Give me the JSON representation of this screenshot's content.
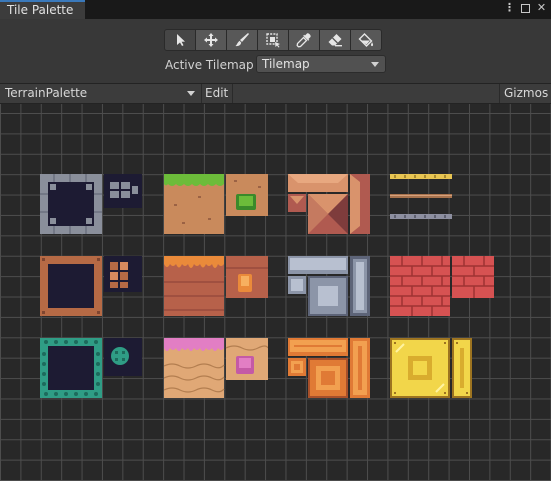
{
  "window": {
    "tab_title": "Tile Palette",
    "menu_icon": "kebab-menu-icon",
    "maximize_icon": "maximize-icon",
    "close_icon": "close-icon"
  },
  "toolbar": {
    "tools": [
      {
        "name": "select-tool",
        "icon": "arrow-cursor-icon",
        "active": true
      },
      {
        "name": "move-tool",
        "icon": "move-arrows-icon",
        "active": false
      },
      {
        "name": "paint-tool",
        "icon": "brush-icon",
        "active": false
      },
      {
        "name": "box-fill-tool",
        "icon": "box-select-icon",
        "active": false
      },
      {
        "name": "picker-tool",
        "icon": "eyedropper-icon",
        "active": false
      },
      {
        "name": "erase-tool",
        "icon": "eraser-icon",
        "active": false
      },
      {
        "name": "fill-tool",
        "icon": "paint-bucket-icon",
        "active": false
      }
    ]
  },
  "active_tilemap": {
    "label": "Active Tilemap",
    "value": "Tilemap"
  },
  "palette_bar": {
    "palette_name": "TerrainPalette",
    "edit_label": "Edit",
    "gizmos_label": "Gizmos"
  },
  "tilesets": [
    {
      "name": "stone-block-set",
      "colors": {
        "fill": "#1d1b33",
        "frame": "#8a8f9b",
        "dark": "#5c6170"
      }
    },
    {
      "name": "grass-dirt-set",
      "colors": {
        "top": "#6cbc3a",
        "dirt": "#c98a5c",
        "dark": "#9b6244"
      }
    },
    {
      "name": "pyramid-roof-set",
      "colors": {
        "light": "#d9936c",
        "mid": "#b05a50",
        "dark": "#7e3c3c"
      }
    },
    {
      "name": "thin-ledge-set",
      "colors": {
        "gold": "#e8c552",
        "brown": "#a8734e",
        "grey": "#8d8fa0"
      }
    },
    {
      "name": "wood-frame-set",
      "colors": {
        "fill": "#1d1b33",
        "frame": "#b66a45",
        "dark": "#7e4530"
      }
    },
    {
      "name": "lava-dirt-set",
      "colors": {
        "top": "#ea8a3a",
        "dirt": "#b7614a",
        "dark": "#8a3f36"
      }
    },
    {
      "name": "metal-plate-set",
      "colors": {
        "light": "#b8c0d0",
        "mid": "#8c95a8",
        "dark": "#5d6478"
      }
    },
    {
      "name": "red-brick-set",
      "colors": {
        "brick": "#d65252",
        "mortar": "#9e3232"
      }
    },
    {
      "name": "teal-cobble-set",
      "colors": {
        "fill": "#1d1b33",
        "frame": "#2f9d85",
        "dark": "#1d6b5c"
      }
    },
    {
      "name": "pink-sand-set",
      "colors": {
        "top": "#e27ec4",
        "sand": "#e0a876",
        "dark": "#b37e50"
      }
    },
    {
      "name": "orange-block-set",
      "colors": {
        "light": "#f2a050",
        "mid": "#e07a35",
        "dark": "#a8502a"
      }
    },
    {
      "name": "gold-block-set",
      "colors": {
        "light": "#f2d64a",
        "mid": "#d9ac2e",
        "dark": "#9d7420"
      }
    }
  ]
}
